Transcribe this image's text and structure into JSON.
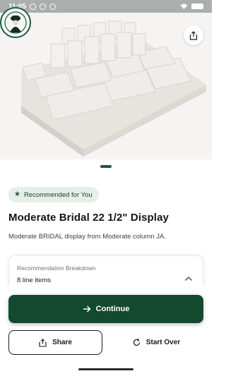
{
  "status_bar": {
    "time": "11:05",
    "icons": [
      "notification-icon",
      "settings-icon",
      "location-icon",
      "wifi-icon",
      "battery-icon"
    ]
  },
  "product": {
    "image_icon": "jewelry-display-photo",
    "share_icon": "share-icon",
    "carousel": {
      "pages": 1,
      "current": 1
    },
    "badge": "Recommended for You",
    "badge_icon": "star-icon",
    "title": "Moderate Bridal 22 1/2\" Display",
    "description": "Moderate BRIDAL display from Moderate column JA."
  },
  "breakdown": {
    "label": "Recommendation Breakdown",
    "value": "8 line items",
    "expanded": false
  },
  "actions": {
    "continue_label": "Continue",
    "share_label": "Share",
    "start_over_label": "Start Over"
  },
  "colors": {
    "primary": "#134a2f",
    "badge_bg": "#e4efe7",
    "pager_active": "#1c5a3b"
  }
}
